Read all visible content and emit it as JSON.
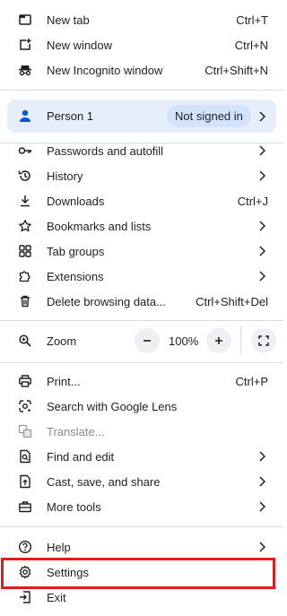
{
  "menu": {
    "new_tab": {
      "label": "New tab",
      "shortcut": "Ctrl+T",
      "icon": "new-tab-icon"
    },
    "new_window": {
      "label": "New window",
      "shortcut": "Ctrl+N",
      "icon": "new-window-icon"
    },
    "new_incognito": {
      "label": "New Incognito window",
      "shortcut": "Ctrl+Shift+N",
      "icon": "incognito-icon"
    },
    "profile": {
      "name": "Person 1",
      "status": "Not signed in",
      "icon": "person-icon"
    },
    "passwords": {
      "label": "Passwords and autofill",
      "icon": "key-icon"
    },
    "history": {
      "label": "History",
      "icon": "history-icon"
    },
    "downloads": {
      "label": "Downloads",
      "shortcut": "Ctrl+J",
      "icon": "download-icon"
    },
    "bookmarks": {
      "label": "Bookmarks and lists",
      "icon": "star-icon"
    },
    "tab_groups": {
      "label": "Tab groups",
      "icon": "tab-groups-icon"
    },
    "extensions": {
      "label": "Extensions",
      "icon": "puzzle-icon"
    },
    "delete_data": {
      "label": "Delete browsing data...",
      "shortcut": "Ctrl+Shift+Del",
      "icon": "trash-icon"
    },
    "zoom": {
      "label": "Zoom",
      "value": "100%",
      "icon": "zoom-icon",
      "minus": "−",
      "plus": "+"
    },
    "print": {
      "label": "Print...",
      "shortcut": "Ctrl+P",
      "icon": "print-icon"
    },
    "lens": {
      "label": "Search with Google Lens",
      "icon": "lens-icon"
    },
    "translate": {
      "label": "Translate...",
      "icon": "translate-icon"
    },
    "find_edit": {
      "label": "Find and edit",
      "icon": "find-icon"
    },
    "cast_save": {
      "label": "Cast, save, and share",
      "icon": "cast-icon"
    },
    "more_tools": {
      "label": "More tools",
      "icon": "toolbox-icon"
    },
    "help": {
      "label": "Help",
      "icon": "help-icon"
    },
    "settings": {
      "label": "Settings",
      "icon": "gear-icon"
    },
    "exit": {
      "label": "Exit",
      "icon": "exit-icon"
    }
  },
  "colors": {
    "highlight": "#e11b22",
    "profile_bg": "#e6eefb",
    "badge_bg": "#d3e3fd"
  }
}
